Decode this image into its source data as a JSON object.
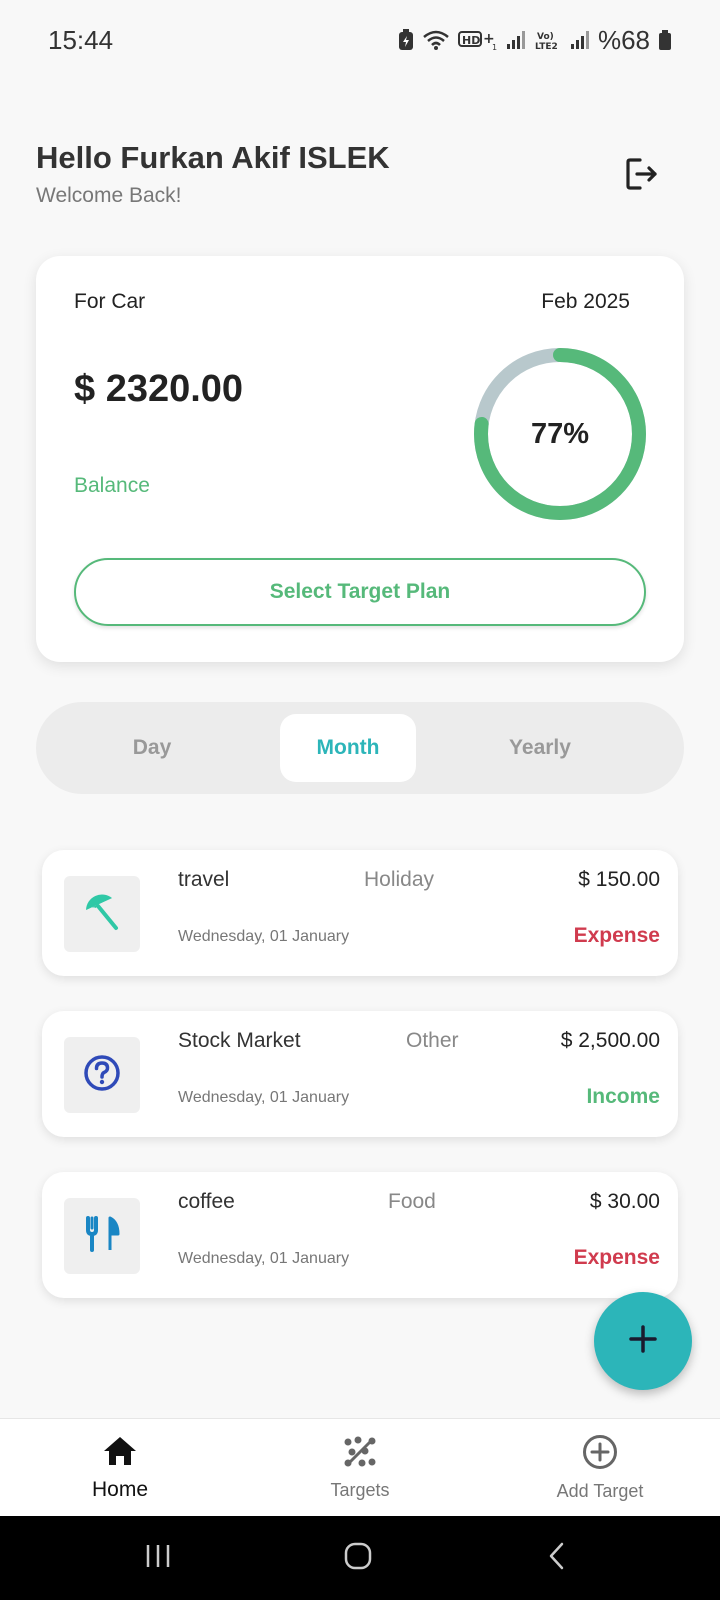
{
  "status_bar": {
    "time": "15:44",
    "battery_text": "%68",
    "icons": [
      "battery-saver-icon",
      "wifi-icon",
      "hd-plus-icon",
      "signal-icon",
      "volte-icon",
      "signal-icon",
      "battery-icon"
    ]
  },
  "header": {
    "greeting": "Hello Furkan Akif ISLEK",
    "subtitle": "Welcome Back!",
    "logout_icon": "logout-icon"
  },
  "balance_card": {
    "title": "For Car",
    "date": "Feb 2025",
    "amount": "$ 2320.00",
    "balance_label": "Balance",
    "progress_text": "77%",
    "progress_value": 0.77,
    "select_plan_label": "Select Target Plan",
    "colors": {
      "progress": "#56b97a",
      "track": "#b8c8cc"
    }
  },
  "period_tabs": {
    "items": [
      "Day",
      "Month",
      "Yearly"
    ],
    "selected": "Month"
  },
  "transactions": [
    {
      "name": "travel",
      "category": "Holiday",
      "amount": "$ 150.00",
      "date": "Wednesday, 01 January",
      "type": "Expense",
      "icon": "beach-umbrella-icon"
    },
    {
      "name": "Stock Market",
      "category": "Other",
      "amount": "$ 2,500.00",
      "date": "Wednesday, 01 January",
      "type": "Income",
      "icon": "question-circle-icon"
    },
    {
      "name": "coffee",
      "category": "Food",
      "amount": "$ 30.00",
      "date": "Wednesday, 01 January",
      "type": "Expense",
      "icon": "restaurant-icon"
    }
  ],
  "fab": {
    "icon": "plus-icon"
  },
  "bottom_nav": {
    "items": [
      {
        "label": "Home",
        "icon": "home-icon",
        "active": true
      },
      {
        "label": "Targets",
        "icon": "targets-icon",
        "active": false
      },
      {
        "label": "Add Target",
        "icon": "add-circle-icon",
        "active": false
      }
    ]
  },
  "system_nav": {
    "icons": [
      "recents-icon",
      "home-circle-icon",
      "back-icon"
    ]
  },
  "colors": {
    "accent": "#2cb5b9",
    "green": "#56b97a",
    "expense": "#d03b4e",
    "background": "#f8f8f8"
  }
}
